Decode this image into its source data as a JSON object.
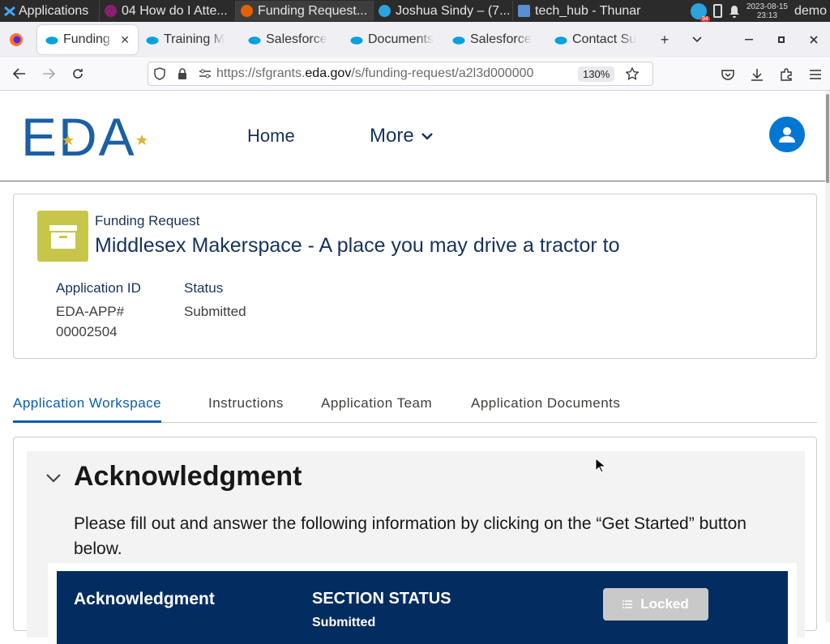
{
  "taskbar": {
    "apps_label": "Applications",
    "windows": [
      {
        "label": "04 How do I Atte...",
        "icon_color": "#8a1f6f"
      },
      {
        "label": "Funding Request...",
        "icon_color": "#e66000",
        "active": true
      },
      {
        "label": "Joshua Sindy – (7...",
        "icon_color": "#2aa3df"
      },
      {
        "label": "tech_hub - Thunar",
        "icon_color": "#5a8fd6"
      }
    ],
    "badge": "94",
    "date": "2023-08-15",
    "time": "23:13",
    "user": "demo"
  },
  "browser": {
    "tabs": [
      {
        "label": "Funding R",
        "active": true
      },
      {
        "label": "Training M"
      },
      {
        "label": "Salesforce"
      },
      {
        "label": "Documents"
      },
      {
        "label": "Salesforce"
      },
      {
        "label": "Contact Su"
      }
    ],
    "url_prefix": "https://sfgrants.",
    "url_domain": "eda.gov",
    "url_path": "/s/funding-request/a2l3d000000",
    "zoom": "130%"
  },
  "site": {
    "logo_text": "EDA",
    "nav_home": "Home",
    "nav_more": "More"
  },
  "record": {
    "type": "Funding Request",
    "title": "Middlesex Makerspace - A place you may drive a tractor to",
    "fields": [
      {
        "label": "Application ID",
        "value_line1": "EDA-APP#",
        "value_line2": "00002504"
      },
      {
        "label": "Status",
        "value": "Submitted"
      }
    ]
  },
  "tabs": [
    "Application Workspace",
    "Instructions",
    "Application Team",
    "Application Documents"
  ],
  "workspace": {
    "heading": "Acknowledgment",
    "instructions": "Please fill out and answer the following information by clicking on the “Get Started” button below.",
    "section": {
      "name": "Acknowledgment",
      "status_label": "SECTION STATUS",
      "status_value": "Submitted",
      "button_label": "Locked"
    }
  },
  "colors": {
    "brand_blue": "#16325c",
    "accent": "#0b5cab",
    "record_icon": "#c8c64a",
    "section_bar": "#032d60"
  }
}
